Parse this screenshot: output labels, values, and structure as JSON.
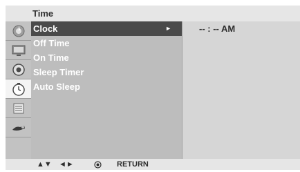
{
  "menu_title": "Time",
  "side_icons": [
    {
      "name": "picture-icon"
    },
    {
      "name": "screen-icon"
    },
    {
      "name": "audio-icon"
    },
    {
      "name": "time-icon",
      "selected": true
    },
    {
      "name": "option-icon"
    },
    {
      "name": "input-icon"
    }
  ],
  "menu_items": [
    {
      "label": "Clock",
      "selected": true,
      "arrow": "►"
    },
    {
      "label": "Off Time"
    },
    {
      "label": "On Time"
    },
    {
      "label": "Sleep Timer"
    },
    {
      "label": "Auto Sleep"
    }
  ],
  "value_panel": {
    "text": "-- : -- AM"
  },
  "footer": {
    "up_down": "▲▼",
    "left_right": "◄►",
    "ok_icon": "ok-button-icon",
    "return_label": "RETURN"
  }
}
